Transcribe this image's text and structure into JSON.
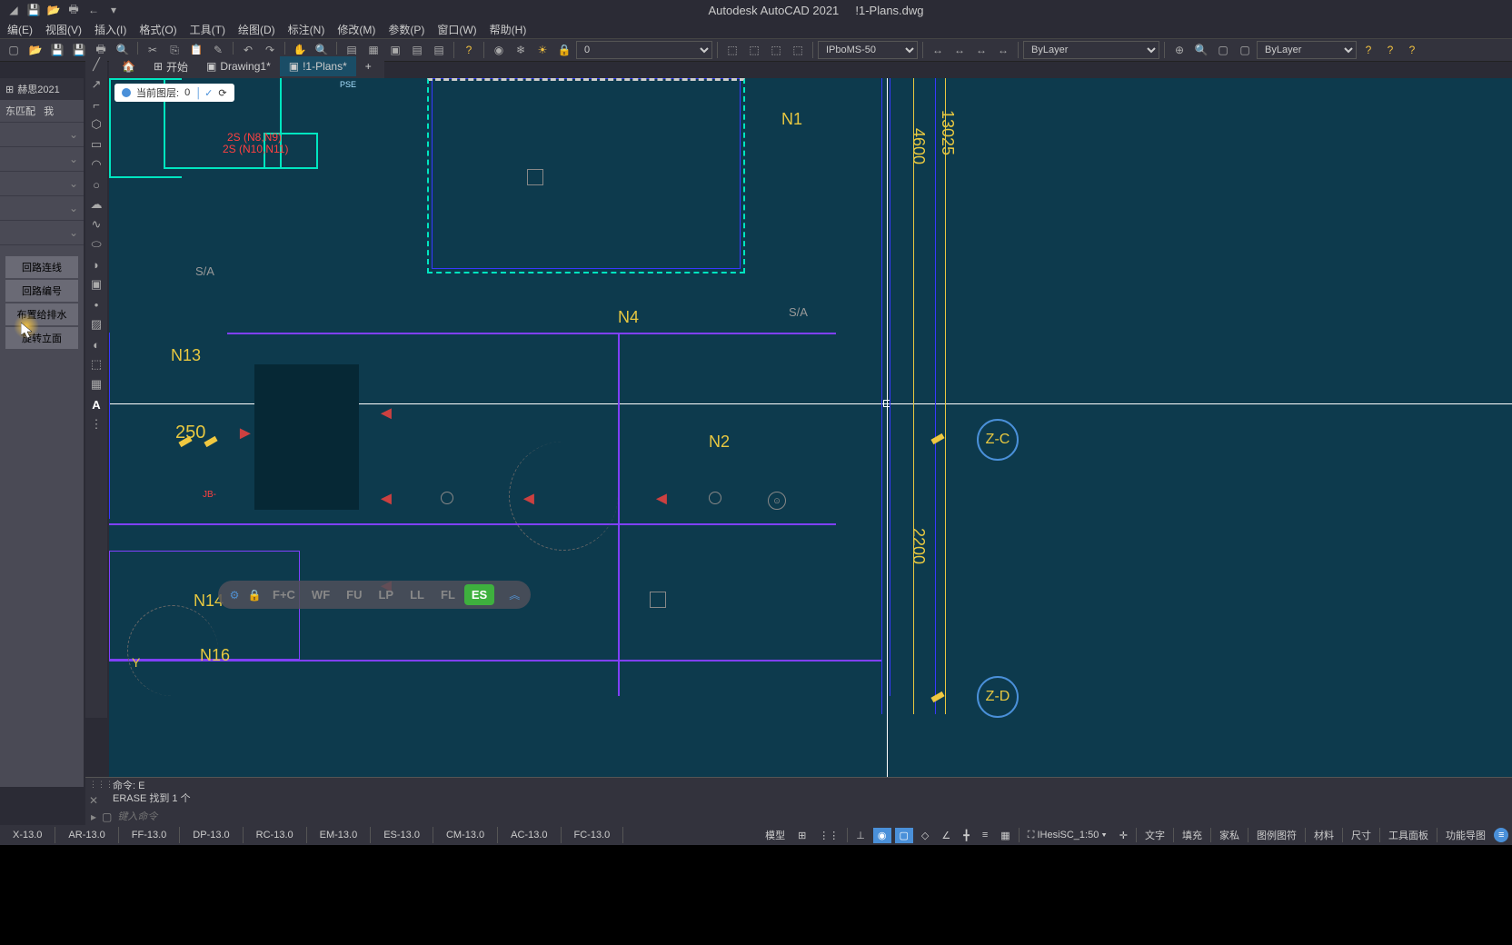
{
  "app": {
    "title": "Autodesk AutoCAD 2021",
    "filename": "!1-Plans.dwg"
  },
  "menu": [
    "编(E)",
    "视图(V)",
    "插入(I)",
    "格式(O)",
    "工具(T)",
    "绘图(D)",
    "标注(N)",
    "修改(M)",
    "参数(P)",
    "窗口(W)",
    "帮助(H)"
  ],
  "doc_tabs": {
    "start": "开始",
    "t1": "Drawing1*",
    "t2": "!1-Plans*"
  },
  "layer_badge": {
    "label": "当前图层:",
    "value": "0"
  },
  "pse": "PSE",
  "toolbar": {
    "layer_sel": "0",
    "lineweight": "IPboMS-50",
    "bylayer1": "ByLayer",
    "bylayer2": "ByLayer"
  },
  "palette": {
    "header": "赫思2021",
    "row1": "东匹配",
    "row1b": "我",
    "btn1": "回路连线",
    "btn2": "回路编号",
    "btn3": "布置给排水",
    "btn4": "旋转立面"
  },
  "drawing": {
    "n1": "N1",
    "n2": "N2",
    "n4": "N4",
    "n13": "N13",
    "n14": "N14",
    "n16": "N16",
    "d250": "250",
    "d4600": "4600",
    "d13025": "13025",
    "d2200": "2200",
    "zc": "Z-C",
    "zd": "Z-D",
    "sa1": "S/A",
    "sa2": "S/A",
    "red1": "2S (N8,N9)",
    "red2": "2S (N10,N11)",
    "jb": "JB-",
    "y_axis": "Y"
  },
  "filters": [
    "F+C",
    "WF",
    "FU",
    "LP",
    "LL",
    "FL",
    "ES"
  ],
  "cmd": {
    "line1": "命令: E",
    "line2": "ERASE 找到 1 个",
    "placeholder": "键入命令"
  },
  "bottom_tabs": [
    "X-13.0",
    "AR-13.0",
    "FF-13.0",
    "DP-13.0",
    "RC-13.0",
    "EM-13.0",
    "ES-13.0",
    "CM-13.0",
    "AC-13.0",
    "FC-13.0"
  ],
  "status": {
    "model": "模型",
    "scale": "IHesiSC_1:50",
    "items": [
      "文字",
      "填充",
      "家私",
      "图例图符",
      "材料",
      "尺寸",
      "工具面板",
      "功能导图"
    ]
  }
}
